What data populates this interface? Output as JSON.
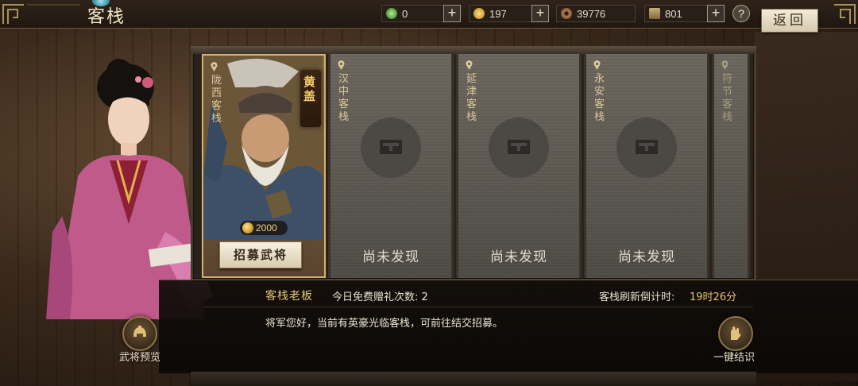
{
  "topbar": {
    "title": "客栈",
    "resources": [
      {
        "name": "jade",
        "value": "0",
        "color": "#5fb05a"
      },
      {
        "name": "gold",
        "value": "197",
        "color": "#e0b23c"
      },
      {
        "name": "copper-coin",
        "value": "39776",
        "color": "#a6784e"
      },
      {
        "name": "tokens",
        "value": "801",
        "color": "#9c8a5c"
      }
    ],
    "plus_label": "+",
    "help_label": "?",
    "back_label": "返回"
  },
  "inns": [
    {
      "name": "陇西客栈",
      "state": "found",
      "general": "黄盖",
      "price": "2000",
      "button": "招募武将"
    },
    {
      "name": "汉中客栈",
      "state": "locked",
      "status": "尚未发现"
    },
    {
      "name": "延津客栈",
      "state": "locked",
      "status": "尚未发现"
    },
    {
      "name": "永安客栈",
      "state": "locked",
      "status": "尚未发现"
    },
    {
      "name": "符节客栈",
      "state": "locked"
    }
  ],
  "dialog": {
    "speaker": "客栈老板",
    "free_gift": "今日免费赠礼次数: 2",
    "countdown_label": "客栈刷新倒计时:",
    "countdown_value": "19时26分",
    "message": "将军您好，当前有英豪光临客栈，可前往结交招募。"
  },
  "actions": {
    "preview_label": "武将预览",
    "befriend_label": "一键结识"
  },
  "colors": {
    "accent_gold": "#e8c36a",
    "panel_gray": "#5b5750",
    "active_border": "#d6b26c"
  }
}
